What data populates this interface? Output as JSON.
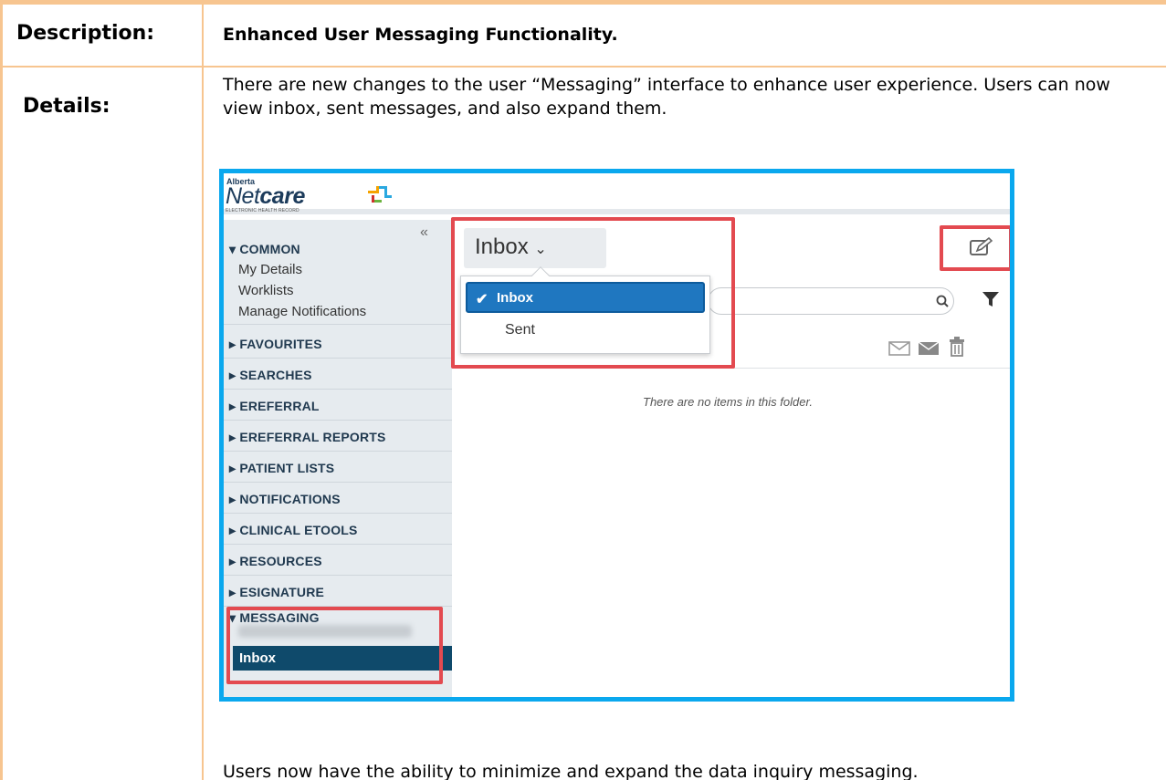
{
  "labels": {
    "description": "Description:",
    "details": "Details:"
  },
  "description_text": "Enhanced User Messaging Functionality.",
  "details_text": "There are new changes to the user “Messaging” interface to enhance user experience. Users can now view inbox, sent messages, and also expand them.",
  "footer_text": "Users now have the ability to minimize and expand the data inquiry messaging.",
  "screenshot": {
    "logo": {
      "small": "Alberta",
      "main_prefix": "Net",
      "main_bold": "care",
      "tagline": "ELECTRONIC HEALTH RECORD"
    },
    "collapse_glyph": "«",
    "sidebar": {
      "common": "COMMON",
      "common_items": [
        "My Details",
        "Worklists",
        "Manage Notifications"
      ],
      "sections": [
        "FAVOURITES",
        "SEARCHES",
        "EREFERRAL",
        "EREFERRAL REPORTS",
        "PATIENT LISTS",
        "NOTIFICATIONS",
        "CLINICAL ETOOLS",
        "RESOURCES",
        "ESIGNATURE"
      ],
      "messaging": "MESSAGING",
      "active_item": "Inbox"
    },
    "folder_button": "Inbox",
    "dropdown": {
      "selected": "Inbox",
      "other": "Sent"
    },
    "empty_message": "There are no items in this folder.",
    "colors": {
      "frame": "#0aa8ee",
      "highlight": "#e34a50",
      "active_nav": "#0f4a6b",
      "selected_option": "#1f77c0",
      "table_rule": "#f7c590"
    }
  }
}
